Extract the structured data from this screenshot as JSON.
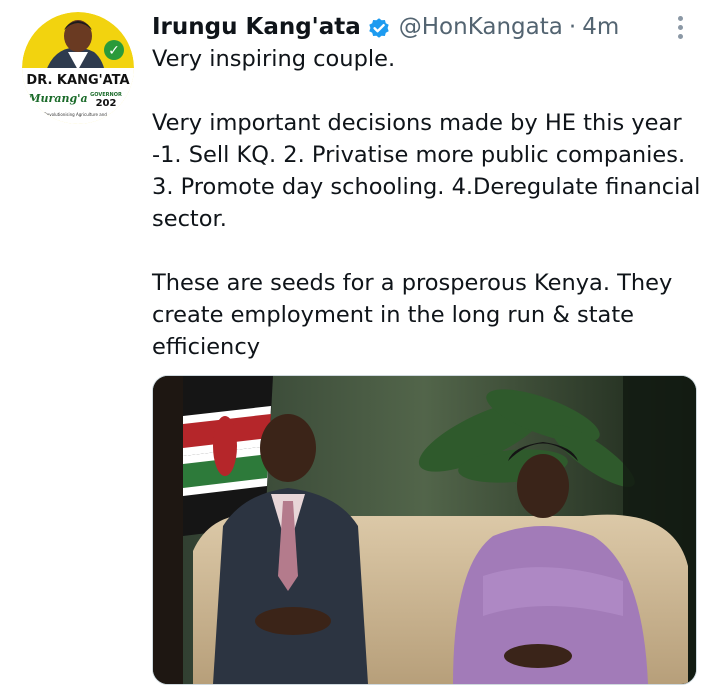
{
  "tweet": {
    "author_name": "Irungu Kang'ata",
    "handle": "@HonKangata",
    "separator": "·",
    "timestamp": "4m",
    "text_lines": [
      "Very inspiring couple.",
      "Very important decisions made by HE this year -1. Sell KQ. 2. Privatise more public companies. 3. Promote day schooling. 4.Deregulate financial sector.",
      "These are seeds for a prosperous Kenya. They create employment in the long run & state efficiency"
    ]
  },
  "avatar": {
    "banner_text": "DR. KANG'ATA",
    "script_text": "Murang'a",
    "office_text": "GOVERNOR",
    "year_text": "202",
    "tagline_text": "Revolutionising Agriculture and ...",
    "check_mark": "✓"
  },
  "icons": {
    "verified": "verified-badge-icon",
    "more": "more-options-icon"
  },
  "colors": {
    "text": "#0f1419",
    "secondary": "#536471",
    "verified_blue": "#1d9bf0",
    "avatar_yellow": "#f2d30f",
    "avatar_green": "#2a9a3a"
  }
}
